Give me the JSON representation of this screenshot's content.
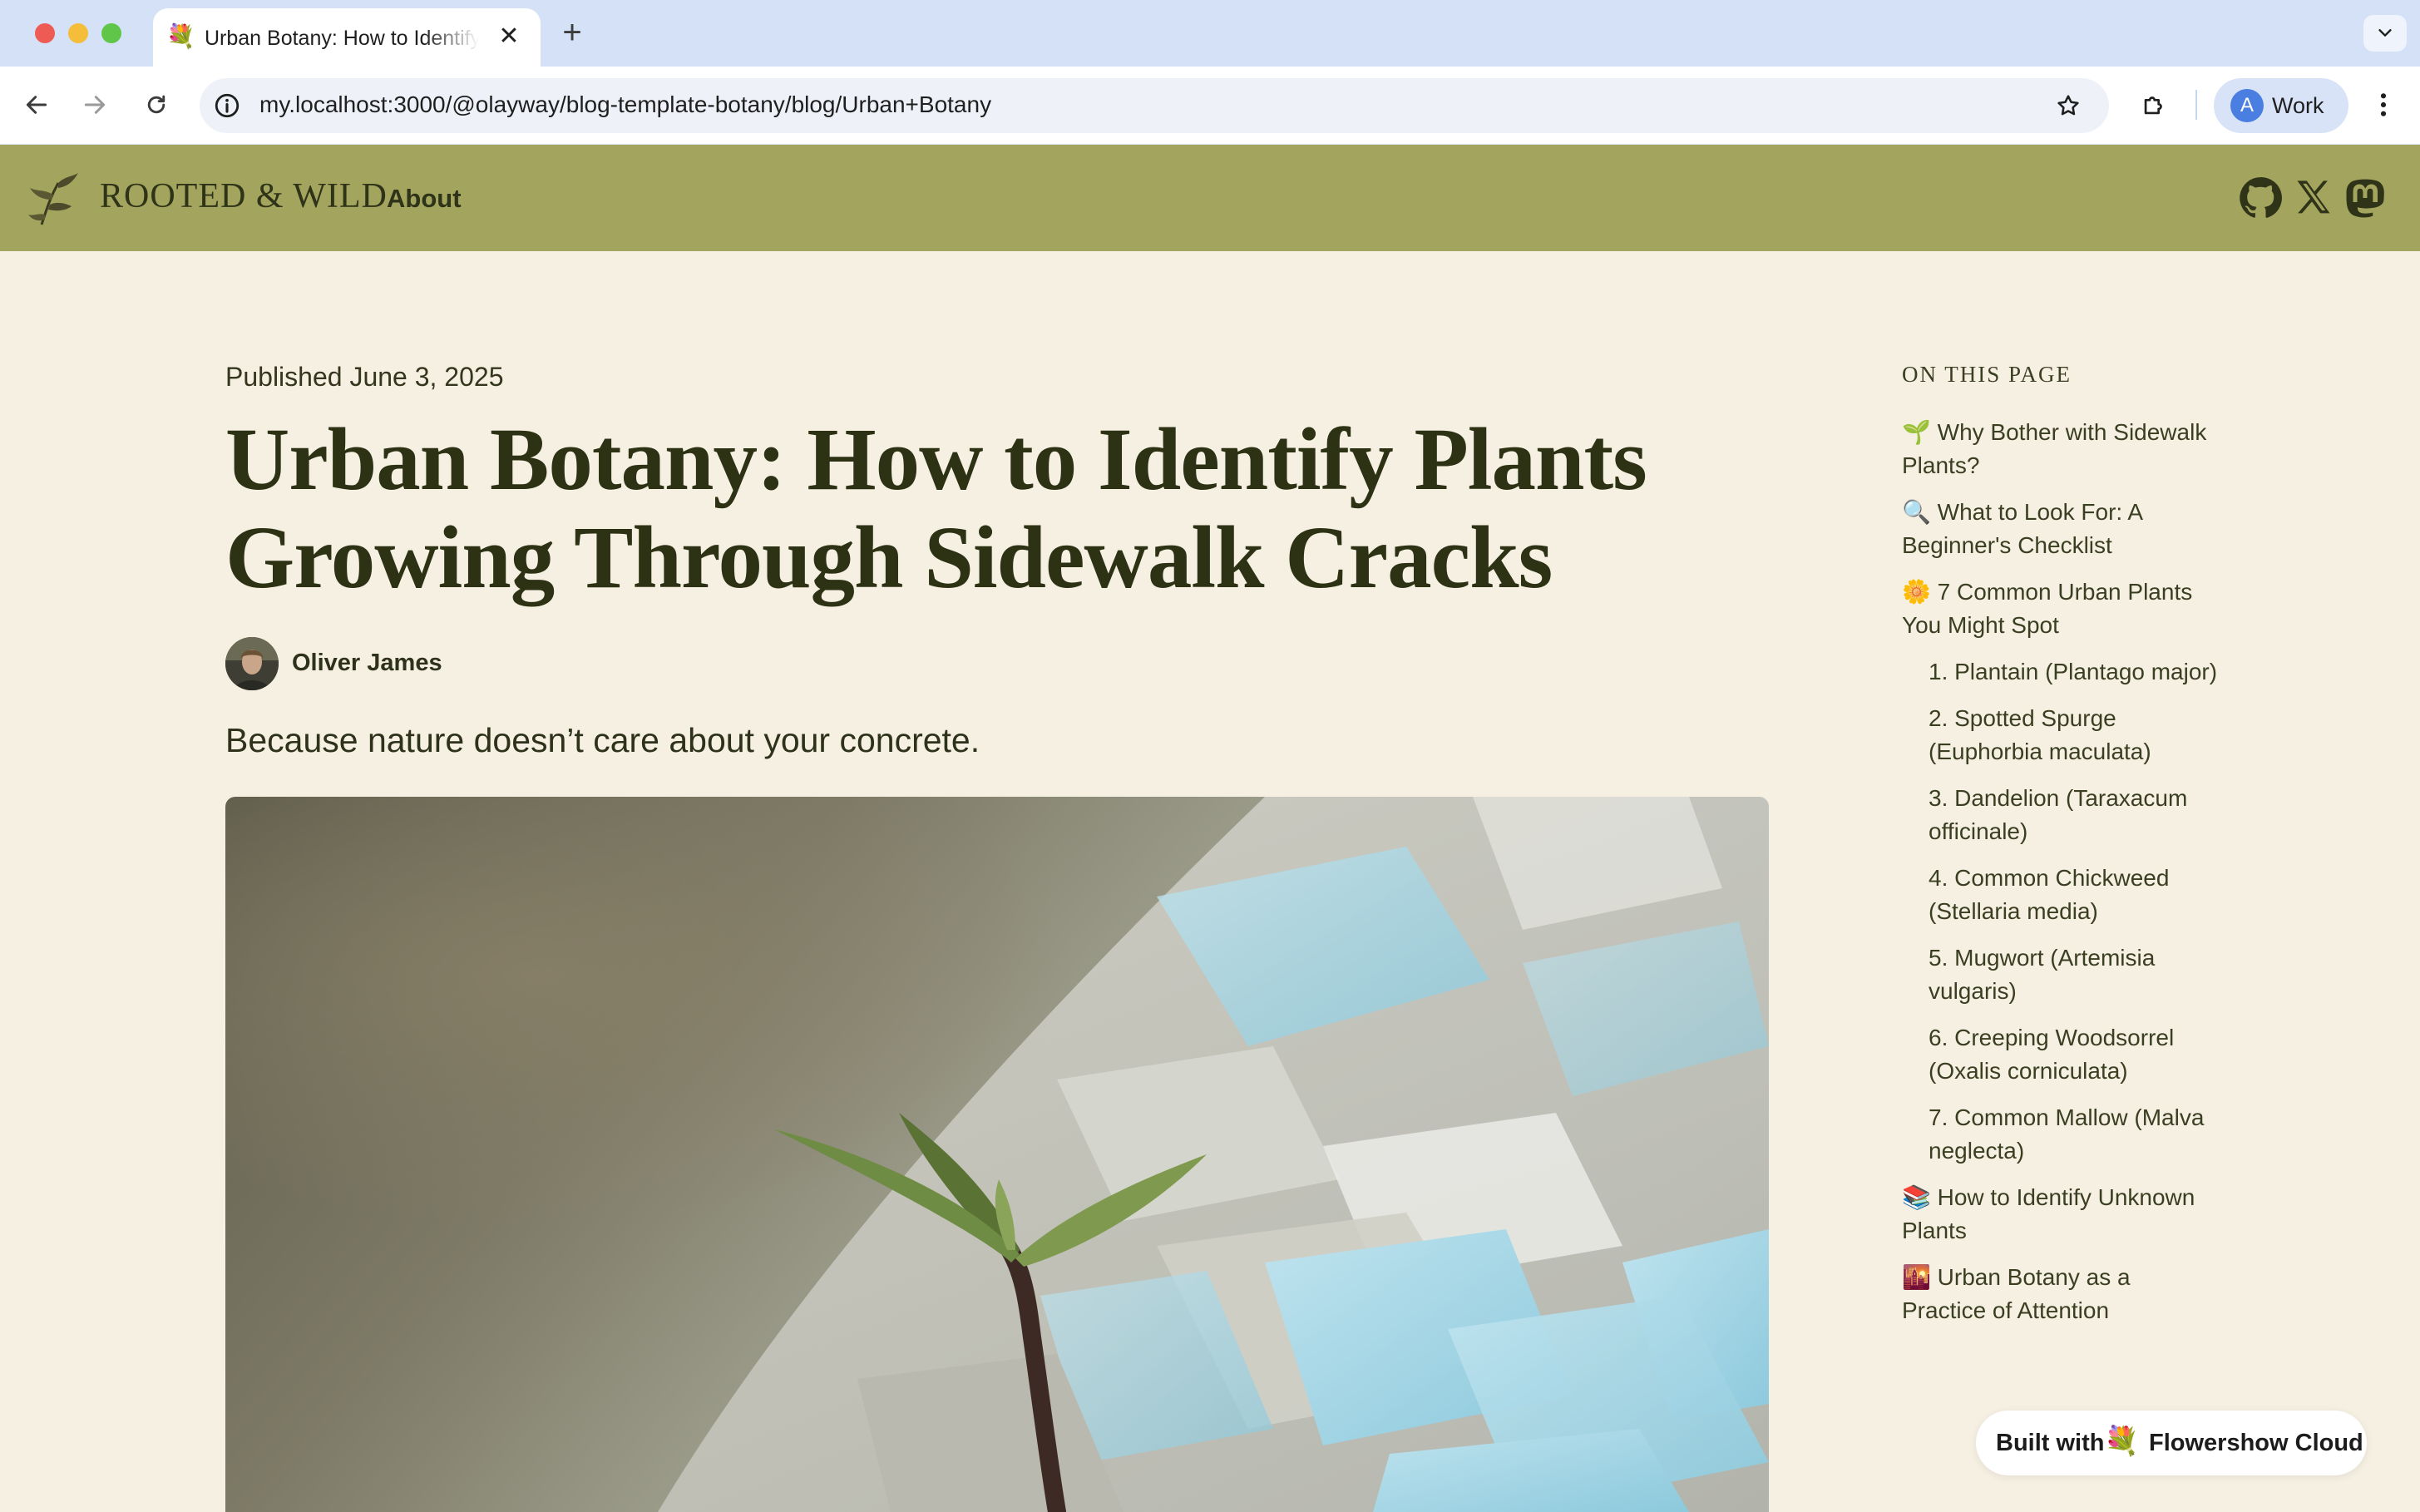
{
  "browser": {
    "tab_icon": "💐",
    "tab_title": "Urban Botany: How to Identify Plants Growing Through Sidewalk Cracks",
    "tab_close": "✕",
    "new_tab": "+",
    "url": "my.localhost:3000/@olayway/blog-template-botany/blog/Urban+Botany",
    "profile_initial": "A",
    "profile_label": "Work"
  },
  "site": {
    "logo_text": "ROOTED & WILD",
    "nav_about": "About",
    "social_icons": [
      "github-icon",
      "x-icon",
      "mastodon-icon"
    ],
    "accent_color": "#a3a55e",
    "background_color": "#f6f0e3"
  },
  "article": {
    "published": "Published June 3, 2025",
    "title": "Urban Botany: How to Identify Plants Growing Through Sidewalk Cracks",
    "author": "Oliver James",
    "subtitle": "Because nature doesn’t care about your concrete."
  },
  "toc": {
    "heading": "ON THIS PAGE",
    "items": [
      {
        "label": "🌱 Why Bother with Sidewalk Plants?",
        "level": 1
      },
      {
        "label": "🔍 What to Look For: A Beginner's Checklist",
        "level": 1
      },
      {
        "label": "🌼 7 Common Urban Plants You Might Spot",
        "level": 1
      },
      {
        "label": "1. Plantain (Plantago major)",
        "level": 2
      },
      {
        "label": "2. Spotted Spurge (Euphorbia maculata)",
        "level": 2
      },
      {
        "label": "3. Dandelion (Taraxacum officinale)",
        "level": 2
      },
      {
        "label": "4. Common Chickweed (Stellaria media)",
        "level": 2
      },
      {
        "label": "5. Mugwort (Artemisia vulgaris)",
        "level": 2
      },
      {
        "label": "6. Creeping Woodsorrel (Oxalis corniculata)",
        "level": 2
      },
      {
        "label": "7. Common Mallow (Malva neglecta)",
        "level": 2
      },
      {
        "label": "📚 How to Identify Unknown Plants",
        "level": 1
      },
      {
        "label": "🌇 Urban Botany as a Practice of Attention",
        "level": 1
      }
    ]
  },
  "badge": {
    "built_with": "Built with",
    "icon": "💐",
    "brand": "Flowershow Cloud"
  }
}
